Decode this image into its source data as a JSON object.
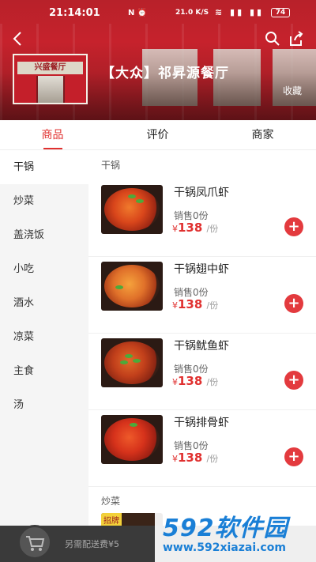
{
  "status_bar": {
    "time": "21:14:01",
    "network": "21.0 K/S",
    "battery": "74"
  },
  "header": {
    "shop_name": "【大众】祁昇源餐厅",
    "favorite_label": "收藏",
    "logo_text": "兴盛餐厅",
    "back_icon": "back-arrow-icon",
    "search_icon": "search-icon",
    "share_icon": "share-icon"
  },
  "tabs": [
    {
      "label": "商品",
      "active": true
    },
    {
      "label": "评价",
      "active": false
    },
    {
      "label": "商家",
      "active": false
    }
  ],
  "sidebar": {
    "items": [
      {
        "label": "干锅"
      },
      {
        "label": "炒菜"
      },
      {
        "label": "盖浇饭"
      },
      {
        "label": "小吃"
      },
      {
        "label": "酒水"
      },
      {
        "label": "凉菜"
      },
      {
        "label": "主食"
      },
      {
        "label": "汤"
      }
    ]
  },
  "menu": {
    "section_title": "干锅",
    "dishes": [
      {
        "name": "干锅凤爪虾",
        "sales": "销售0份",
        "currency": "¥",
        "price": "138",
        "unit": "/份"
      },
      {
        "name": "干锅翅中虾",
        "sales": "销售0份",
        "currency": "¥",
        "price": "138",
        "unit": "/份"
      },
      {
        "name": "干锅鱿鱼虾",
        "sales": "销售0份",
        "currency": "¥",
        "price": "138",
        "unit": "/份"
      },
      {
        "name": "干锅排骨虾",
        "sales": "销售0份",
        "currency": "¥",
        "price": "138",
        "unit": "/份"
      }
    ],
    "add_symbol": "+",
    "next_section_title": "炒菜",
    "next_badge": "招牌"
  },
  "cart": {
    "icon": "cart-icon",
    "delivery_text": "另需配送费¥5"
  },
  "watermark": {
    "main": "592软件园",
    "url": "www.592xiazai.com"
  },
  "colors": {
    "brand_red": "#e0302f",
    "add_button": "#e33a3e",
    "bottom_bar": "#3a3a3a"
  }
}
